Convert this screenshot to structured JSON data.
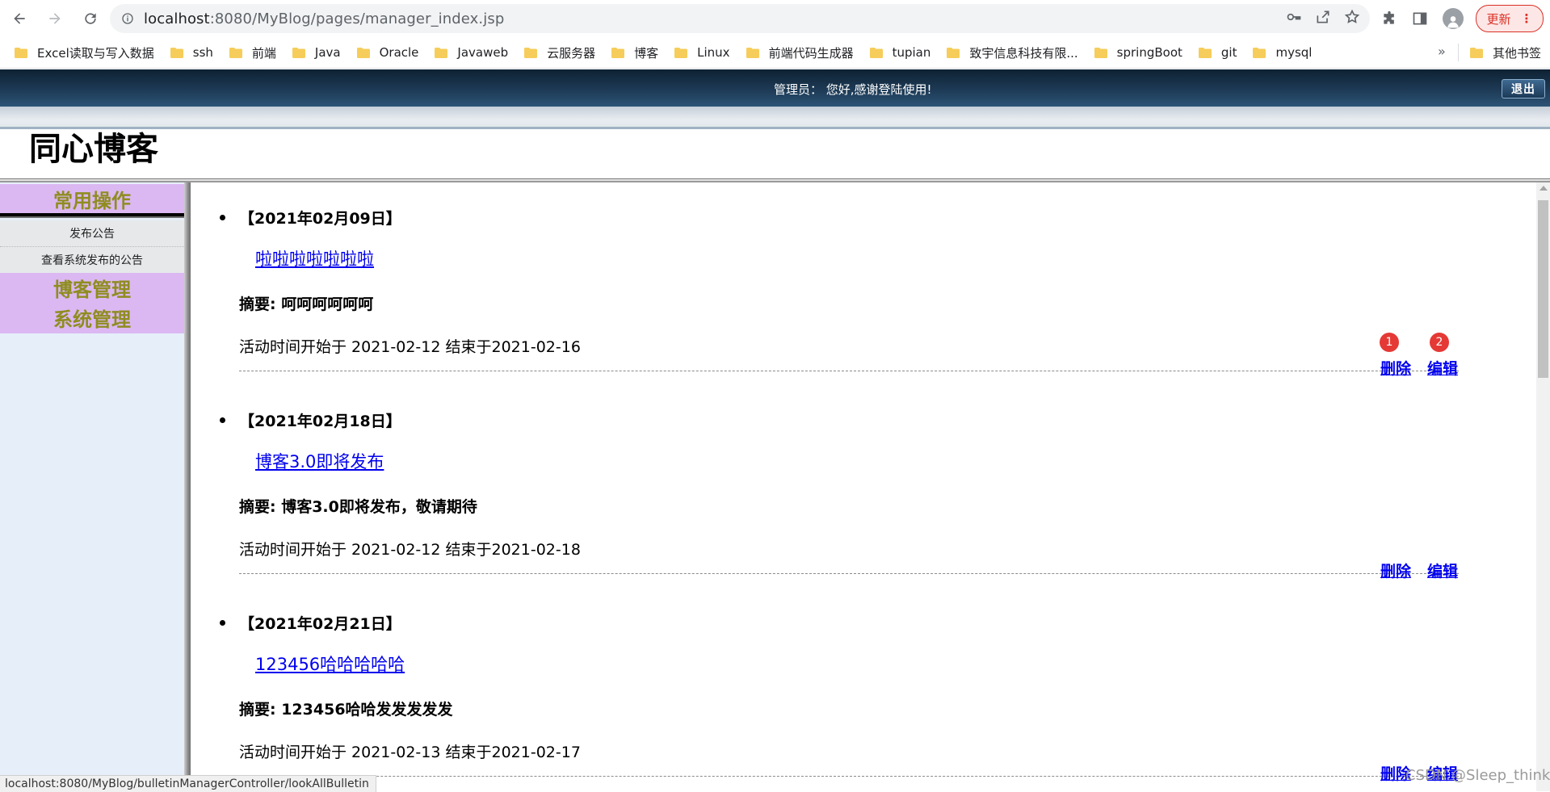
{
  "browser": {
    "url_host": "localhost",
    "url_path": ":8080/MyBlog/pages/manager_index.jsp",
    "update_label": "更新",
    "bookmarks": [
      "Excel读取与写入数据",
      "ssh",
      "前端",
      "Java",
      "Oracle",
      "Javaweb",
      "云服务器",
      "博客",
      "Linux",
      "前端代码生成器",
      "tupian",
      "致宇信息科技有限...",
      "springBoot",
      "git",
      "mysql"
    ],
    "more_label": "»",
    "other_bookmarks": "其他书签",
    "status_url": "localhost:8080/MyBlog/bulletinManagerController/lookAllBulletin"
  },
  "header": {
    "welcome": "管理员： 您好,感谢登陆使用!",
    "logout_label": "退出",
    "site_title": "同心博客"
  },
  "sidebar": {
    "sections": [
      {
        "title": "常用操作",
        "items": [
          "发布公告",
          "查看系统发布的公告"
        ]
      },
      {
        "title": "博客管理"
      },
      {
        "title": "系统管理"
      }
    ]
  },
  "bulletins": [
    {
      "date": "【2021年02月09日】",
      "title": "啦啦啦啦啦啦啦",
      "summary": "摘要: 呵呵呵呵呵呵",
      "time": "活动时间开始于 2021-02-12 结束于2021-02-16",
      "delete_label": "删除",
      "edit_label": "编辑",
      "badges": [
        "1",
        "2"
      ]
    },
    {
      "date": "【2021年02月18日】",
      "title": "博客3.0即将发布",
      "summary": "摘要: 博客3.0即将发布，敬请期待",
      "time": "活动时间开始于 2021-02-12 结束于2021-02-18",
      "delete_label": "删除",
      "edit_label": "编辑"
    },
    {
      "date": "【2021年02月21日】",
      "title": "123456哈哈哈哈哈",
      "summary": "摘要: 123456哈哈发发发发发",
      "time": "活动时间开始于 2021-02-13 结束于2021-02-17",
      "delete_label": "删除",
      "edit_label": "编辑"
    }
  ],
  "watermark": "CSDN @Sleep_thinking"
}
